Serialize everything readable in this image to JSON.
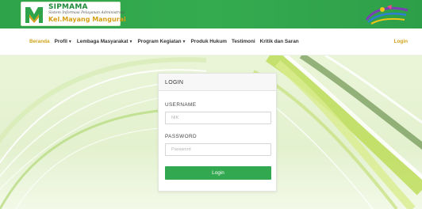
{
  "header": {
    "logo": {
      "title": "SIPMAMA",
      "subtitle": "Sistem Informasi Pelayanan Administrasi",
      "place": "Kel.Mayang Mangurai"
    },
    "brand_icon": "tourism-logo-icon"
  },
  "nav": {
    "items": [
      {
        "label": "Beranda",
        "dropdown": false,
        "active": true
      },
      {
        "label": "Profil",
        "dropdown": true,
        "active": false
      },
      {
        "label": "Lembaga Masyarakat",
        "dropdown": true,
        "active": false
      },
      {
        "label": "Program Kegiatan",
        "dropdown": true,
        "active": false
      },
      {
        "label": "Produk Hukum",
        "dropdown": false,
        "active": false
      },
      {
        "label": "Testimoni",
        "dropdown": false,
        "active": false
      },
      {
        "label": "Kritik dan Saran",
        "dropdown": false,
        "active": false
      }
    ],
    "login": "Login"
  },
  "login_card": {
    "title": "LOGIN",
    "username_label": "USERNAME",
    "username_placeholder": "NIK",
    "password_label": "PASSWORD",
    "password_placeholder": "Password",
    "submit": "Login"
  },
  "colors": {
    "primary_green": "#32a850",
    "accent_gold": "#cfa21a",
    "hero_background": "#e3f1cf"
  }
}
